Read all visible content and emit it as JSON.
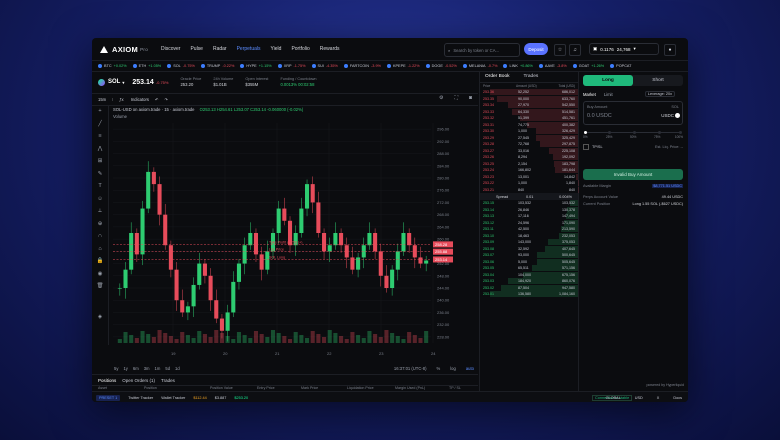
{
  "nav": {
    "logo": "AXIOM",
    "logo_sub": "Pro",
    "items": [
      "Discover",
      "Pulse",
      "Radar",
      "Perpetuals",
      "Yield",
      "Portfolio",
      "Rewards"
    ],
    "active_index": 3,
    "search_placeholder": "Search by token or CA...",
    "deposit": "Deposit",
    "balance_a": "0.1176",
    "balance_b": "24,768"
  },
  "tickers": [
    {
      "sym": "BTC",
      "chg": "+0.02%",
      "up": true
    },
    {
      "sym": "ETH",
      "chg": "+1.05%",
      "up": true
    },
    {
      "sym": "SOL",
      "chg": "-0.75%",
      "up": false
    },
    {
      "sym": "TRUMP",
      "chg": "-0.22%",
      "up": false
    },
    {
      "sym": "HYPE",
      "chg": "+1.15%",
      "up": true
    },
    {
      "sym": "XRP",
      "chg": "-1.75%",
      "up": false
    },
    {
      "sym": "SUI",
      "chg": "-4.35%",
      "up": false
    },
    {
      "sym": "FARTCOIN",
      "chg": "-3.9%",
      "up": false
    },
    {
      "sym": "KPEPE",
      "chg": "-1.22%",
      "up": false
    },
    {
      "sym": "DOGE",
      "chg": "-0.52%",
      "up": false
    },
    {
      "sym": "MELANIA",
      "chg": "-0.7%",
      "up": false
    },
    {
      "sym": "LINK",
      "chg": "+0.86%",
      "up": true
    },
    {
      "sym": "AAVE",
      "chg": "-3.8%",
      "up": false
    },
    {
      "sym": "GOAT",
      "chg": "+1.26%",
      "up": true
    },
    {
      "sym": "POPCAT",
      "chg": "",
      "up": true
    }
  ],
  "symbol": {
    "name": "SOL",
    "price": "253.14",
    "change": "-0.75%",
    "stats": [
      {
        "label": "Oracle Price",
        "value": "253.20"
      },
      {
        "label": "24h Volume",
        "value": "$1.01B"
      },
      {
        "label": "Open Interest",
        "value": "$355M"
      },
      {
        "label": "Funding / Countdown",
        "value": "0.0013% 00:02:58"
      }
    ]
  },
  "toolbar": {
    "interval": "15m",
    "indicators": "Indicators"
  },
  "chart_info": {
    "title": "SOL-USD on axiom.trade · 15 · axiom.trade",
    "ohlc": "O253.13 H254.61 L253.07 C253.14 -0.060000 (-0.02%)",
    "volume_label": "Volume"
  },
  "chart_data": {
    "type": "candlestick",
    "x_ticks": [
      "19",
      "20",
      "21",
      "22",
      "23",
      "24"
    ],
    "y_ticks": [
      "296.00",
      "292.00",
      "288.00",
      "284.00",
      "280.00",
      "276.00",
      "272.00",
      "268.00",
      "264.00",
      "260.00",
      "256.00",
      "252.00",
      "248.00",
      "244.00",
      "240.00",
      "236.00",
      "232.00",
      "228.00"
    ],
    "ylim": [
      226,
      298
    ],
    "price_lines": [
      {
        "label": "Take Profit at 259 (+)",
        "price": 258.28,
        "tag": "258.28",
        "color": "#e74c5b"
      },
      {
        "label": "SOL Long",
        "price": 253.34,
        "tag": "253.14",
        "color": "#e74c5b"
      },
      {
        "label": "Liq. Price",
        "price": 255.88,
        "tag": "255.88",
        "color": "#e74c5b"
      }
    ],
    "closes": [
      244,
      250,
      262,
      255,
      270,
      282,
      278,
      268,
      258,
      250,
      240,
      236,
      238,
      245,
      252,
      248,
      240,
      234,
      230,
      236,
      246,
      252,
      258,
      262,
      255,
      250,
      256,
      262,
      270,
      266,
      258,
      262,
      270,
      278,
      272,
      262,
      256,
      258,
      262,
      258,
      254,
      250,
      254,
      258,
      262,
      256,
      248,
      244,
      250,
      256,
      262,
      258,
      254,
      252,
      253
    ]
  },
  "chart_footer": {
    "ranges": [
      "5y",
      "1y",
      "6m",
      "3m",
      "1m",
      "5d",
      "1d"
    ],
    "time": "16:37:01 (UTC-8)",
    "scale": [
      "%",
      "log",
      "auto"
    ]
  },
  "positions": {
    "tabs": [
      "Positions",
      "Open Orders (1)",
      "Trades"
    ],
    "headers": [
      "Asset",
      "Position",
      "Position Value",
      "Entry Price",
      "Mark Price",
      "Liquidation Price",
      "Margin Used (PnL)",
      "TP / SL",
      "Close"
    ],
    "row": [
      "SOL",
      "Long 1.55 SOL",
      "$393.60",
      "$253.24",
      "$253.4",
      "$249.88",
      "$16.67 (-$0.18 (0.75%))",
      "$259.00 / --",
      "Market Limit"
    ]
  },
  "orderbook": {
    "tabs": [
      "Order Book",
      "Trades"
    ],
    "headers": [
      "Price",
      "Amount (USD)",
      "Total (USD)"
    ],
    "asks": [
      [
        "253.36",
        "52,252",
        "686,012"
      ],
      [
        "253.35",
        "90,000",
        "633,760"
      ],
      [
        "253.34",
        "27,970",
        "542,550"
      ],
      [
        "253.33",
        "64,330",
        "514,581"
      ],
      [
        "253.32",
        "51,399",
        "451,761"
      ],
      [
        "253.31",
        "74,775",
        "400,382"
      ],
      [
        "253.30",
        "1,000",
        "326,429"
      ],
      [
        "253.29",
        "27,545",
        "325,429"
      ],
      [
        "253.28",
        "72,768",
        "297,875"
      ],
      [
        "253.27",
        "33,016",
        "225,108"
      ],
      [
        "253.26",
        "8,294",
        "192,092"
      ],
      [
        "253.25",
        "2,154",
        "183,798"
      ],
      [
        "253.24",
        "166,802",
        "181,644"
      ],
      [
        "253.23",
        "13,001",
        "14,842"
      ],
      [
        "253.22",
        "1,000",
        "1,840"
      ],
      [
        "253.21",
        "840",
        "840"
      ]
    ],
    "spread": [
      "Spread",
      "0.01",
      "0.004%"
    ],
    "bids": [
      [
        "253.15",
        "103,532",
        "103,532"
      ],
      [
        "253.14",
        "26,846",
        "130,378"
      ],
      [
        "253.13",
        "17,116",
        "147,494"
      ],
      [
        "253.12",
        "24,596",
        "171,090"
      ],
      [
        "253.11",
        "42,500",
        "213,590"
      ],
      [
        "253.10",
        "18,463",
        "232,053"
      ],
      [
        "253.09",
        "143,000",
        "375,053"
      ],
      [
        "253.08",
        "32,592",
        "407,645"
      ],
      [
        "253.07",
        "93,000",
        "500,645"
      ],
      [
        "253.06",
        "5,000",
        "505,645"
      ],
      [
        "253.05",
        "65,511",
        "571,156"
      ],
      [
        "253.04",
        "104,000",
        "675,156"
      ],
      [
        "253.03",
        "184,920",
        "860,076"
      ],
      [
        "253.02",
        "87,504",
        "947,580"
      ],
      [
        "253.01",
        "136,580",
        "1,084,160"
      ]
    ]
  },
  "order_form": {
    "long": "Long",
    "short": "Short",
    "types": [
      "Market",
      "Limit"
    ],
    "leverage": "Leverage: 20x",
    "amount_label": "Buy Amount",
    "amount_placeholder": "0.0 USDC",
    "amount_currency": "SOL",
    "amount_unit": "USDC",
    "slider_marks": [
      "0%",
      "25%",
      "50%",
      "75%",
      "100%"
    ],
    "tpsl": "TP/SL",
    "price_type": "Est. Liq. Price: --",
    "buy_button": "Invalid Buy Amount",
    "info": [
      {
        "label": "Available Margin",
        "value": "$8,771.51 USDC"
      },
      {
        "label": "Perps Account Value",
        "value": "49.44 USDC"
      },
      {
        "label": "Current Position",
        "value": "Long 1.55 SOL (-$627 USDC)"
      }
    ],
    "powered": "powered by Hyperliquid"
  },
  "statusbar": {
    "preset": "PRESET 1",
    "items": [
      "Twitter Tracker",
      "Wallet Tracker",
      "$112.44",
      "$3.887",
      "$253.20"
    ],
    "connection": "Connection is stable",
    "right": [
      "GLOBAL",
      "USD",
      "X",
      "Docs"
    ]
  }
}
